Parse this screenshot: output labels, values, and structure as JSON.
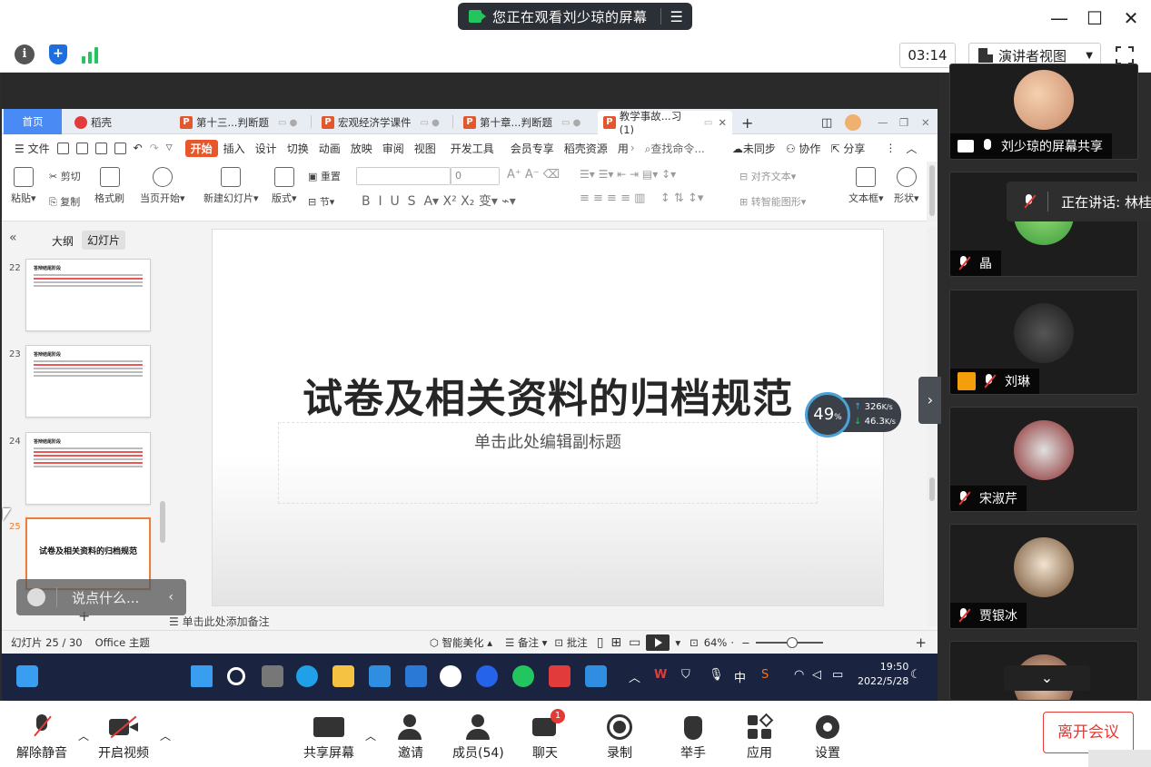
{
  "meeting": {
    "banner_text": "您正在观看刘少琼的屏幕",
    "timer": "03:14",
    "view_mode": "演讲者视图"
  },
  "wps": {
    "tabs": {
      "home": "首页",
      "daoke": "稻壳",
      "t1": "第十三...判断题",
      "t2": "宏观经济学课件",
      "t3": "第十章...判断题",
      "t4": "教学事故...习(1)"
    },
    "menu": {
      "file": "文件",
      "start": "开始",
      "insert": "插入",
      "design": "设计",
      "switch": "切换",
      "anim": "动画",
      "slideshow": "放映",
      "review": "审阅",
      "view": "视图",
      "dev": "开发工具",
      "member": "会员专享",
      "daoke_res": "稻壳资源",
      "more": "用",
      "search": "查找命令...",
      "unsync": "未同步",
      "collab": "协作",
      "share": "分享"
    },
    "ribbon": {
      "paste": "粘贴",
      "cut": "剪切",
      "copy": "复制",
      "format_brush": "格式刷",
      "from_current": "当页开始",
      "new_slide": "新建幻灯片",
      "layout": "版式",
      "reset": "重置",
      "section": "节",
      "font_size": "0",
      "align_text": "对齐文本",
      "smart_shape": "转智能图形",
      "textbox": "文本框",
      "shape": "形状"
    },
    "side": {
      "outline": "大纲",
      "slides": "幻灯片"
    },
    "thumbs": [
      {
        "num": "22",
        "title": "答辩结尾阶段"
      },
      {
        "num": "23",
        "title": "答辩结尾阶段"
      },
      {
        "num": "24",
        "title": "答辩结尾阶段"
      },
      {
        "num": "25",
        "title": "试卷及相关资料的归档规范"
      }
    ],
    "slide": {
      "title": "试卷及相关资料的归档规范",
      "subtitle": "单击此处编辑副标题"
    },
    "notes": "单击此处添加备注",
    "status": {
      "slide_no": "幻灯片 25 / 30",
      "theme": "Office 主题",
      "beautify": "智能美化",
      "notes": "备注",
      "comment": "批注",
      "zoom": "64%"
    },
    "chat_placeholder": "说点什么..."
  },
  "network": {
    "cpu": "49",
    "cpu_unit": "%",
    "up": "326",
    "down": "46.3",
    "unit": "K/s"
  },
  "taskbar": {
    "time": "19:50",
    "date": "2022/5/28",
    "tray_w": "W",
    "tray_zh": "中"
  },
  "participants": [
    {
      "name": "刘少琼的屏幕共享"
    },
    {
      "name": "晶"
    },
    {
      "name": "刘琳"
    },
    {
      "name": "宋淑芹"
    },
    {
      "name": "贾银冰"
    }
  ],
  "speaking": "正在讲话: 林桂",
  "bottom": {
    "unmute": "解除静音",
    "start_video": "开启视频",
    "share_screen": "共享屏幕",
    "invite": "邀请",
    "members": "成员(54)",
    "chat": "聊天",
    "chat_badge": "1",
    "record": "录制",
    "raise_hand": "举手",
    "apps": "应用",
    "settings": "设置",
    "leave": "离开会议"
  }
}
